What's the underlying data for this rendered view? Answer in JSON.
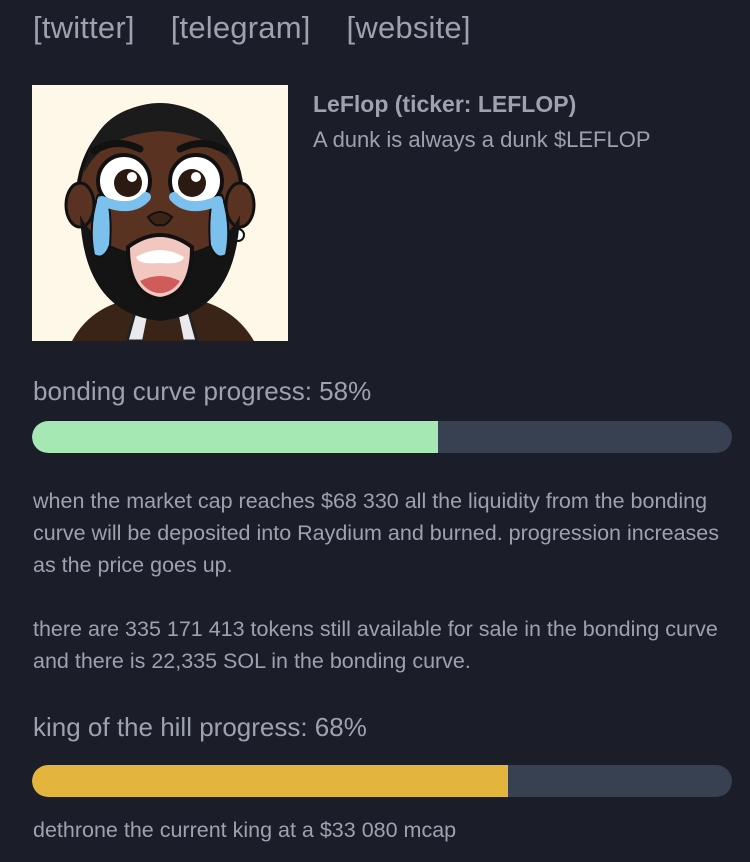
{
  "links": [
    "[twitter]",
    "[telegram]",
    "[website]"
  ],
  "coin": {
    "title": "LeFlop (ticker: LEFLOP)",
    "description": "A dunk is always a dunk $LEFLOP"
  },
  "bonding_curve": {
    "label": "bonding curve progress: 58%",
    "progress_percent": 58,
    "color": "#a5e8b3",
    "info_1": "when the market cap reaches $68 330 all the liquidity from the bonding curve will be deposited into Raydium and burned. progression increases as the price goes up.",
    "info_2": "there are 335 171 413 tokens still available for sale in the bonding curve and there is 22,335 SOL in the bonding curve."
  },
  "king_of_the_hill": {
    "label": "king of the hill progress: 68%",
    "progress_percent": 68,
    "color": "#e4b53d",
    "info": "dethrone the current king at a $33 080 mcap"
  },
  "colors": {
    "background": "#1b1d28",
    "text": "#9ca3af",
    "track": "#374151"
  }
}
